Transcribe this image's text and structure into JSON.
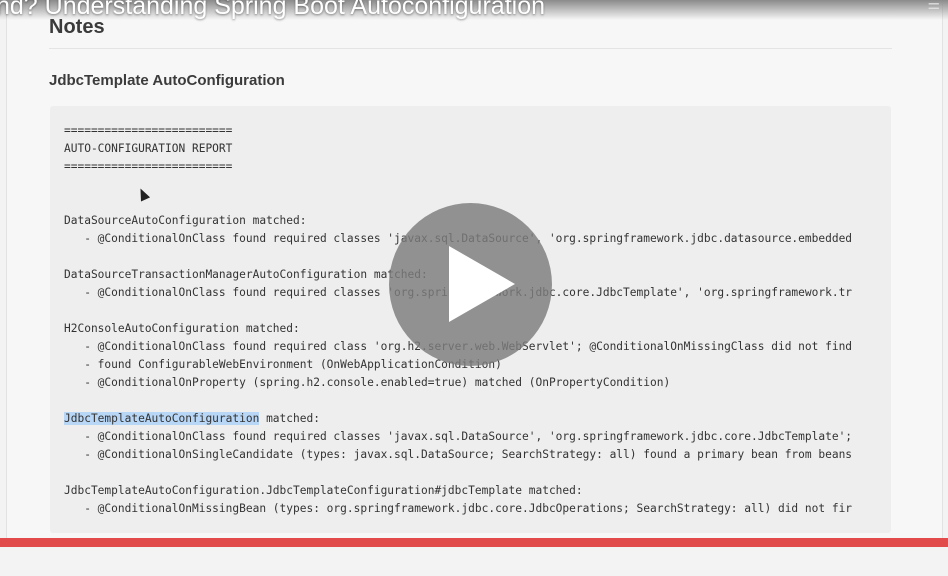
{
  "video": {
    "title": "nd? Understanding Spring Boot Autoconfiguration",
    "progress": 1.0
  },
  "notes": {
    "heading": "Notes",
    "section_heading": "JdbcTemplate AutoConfiguration"
  },
  "code": {
    "lines": [
      "=========================",
      "AUTO-CONFIGURATION REPORT",
      "=========================",
      "",
      "",
      "DataSourceAutoConfiguration matched:",
      "   - @ConditionalOnClass found required classes 'javax.sql.DataSource', 'org.springframework.jdbc.datasource.embedded",
      "",
      "DataSourceTransactionManagerAutoConfiguration matched:",
      "   - @ConditionalOnClass found required classes 'org.springframework.jdbc.core.JdbcTemplate', 'org.springframework.tr",
      "",
      "H2ConsoleAutoConfiguration matched:",
      "   - @ConditionalOnClass found required class 'org.h2.server.web.WebServlet'; @ConditionalOnMissingClass did not find",
      "   - found ConfigurableWebEnvironment (OnWebApplicationCondition)",
      "   - @ConditionalOnProperty (spring.h2.console.enabled=true) matched (OnPropertyCondition)",
      "",
      "",
      "   - @ConditionalOnClass found required classes 'javax.sql.DataSource', 'org.springframework.jdbc.core.JdbcTemplate';",
      "   - @ConditionalOnSingleCandidate (types: javax.sql.DataSource; SearchStrategy: all) found a primary bean from beans",
      "",
      "JdbcTemplateAutoConfiguration.JdbcTemplateConfiguration#jdbcTemplate matched:",
      "   - @ConditionalOnMissingBean (types: org.springframework.jdbc.core.JdbcOperations; SearchStrategy: all) did not fir"
    ],
    "highlighted_word": "JdbcTemplateAutoConfiguration",
    "highlighted_line_rest": " matched:"
  },
  "colors": {
    "progress": "#e14b4b",
    "highlight": "#b8d6f5",
    "code_bg": "#eeeeee"
  }
}
